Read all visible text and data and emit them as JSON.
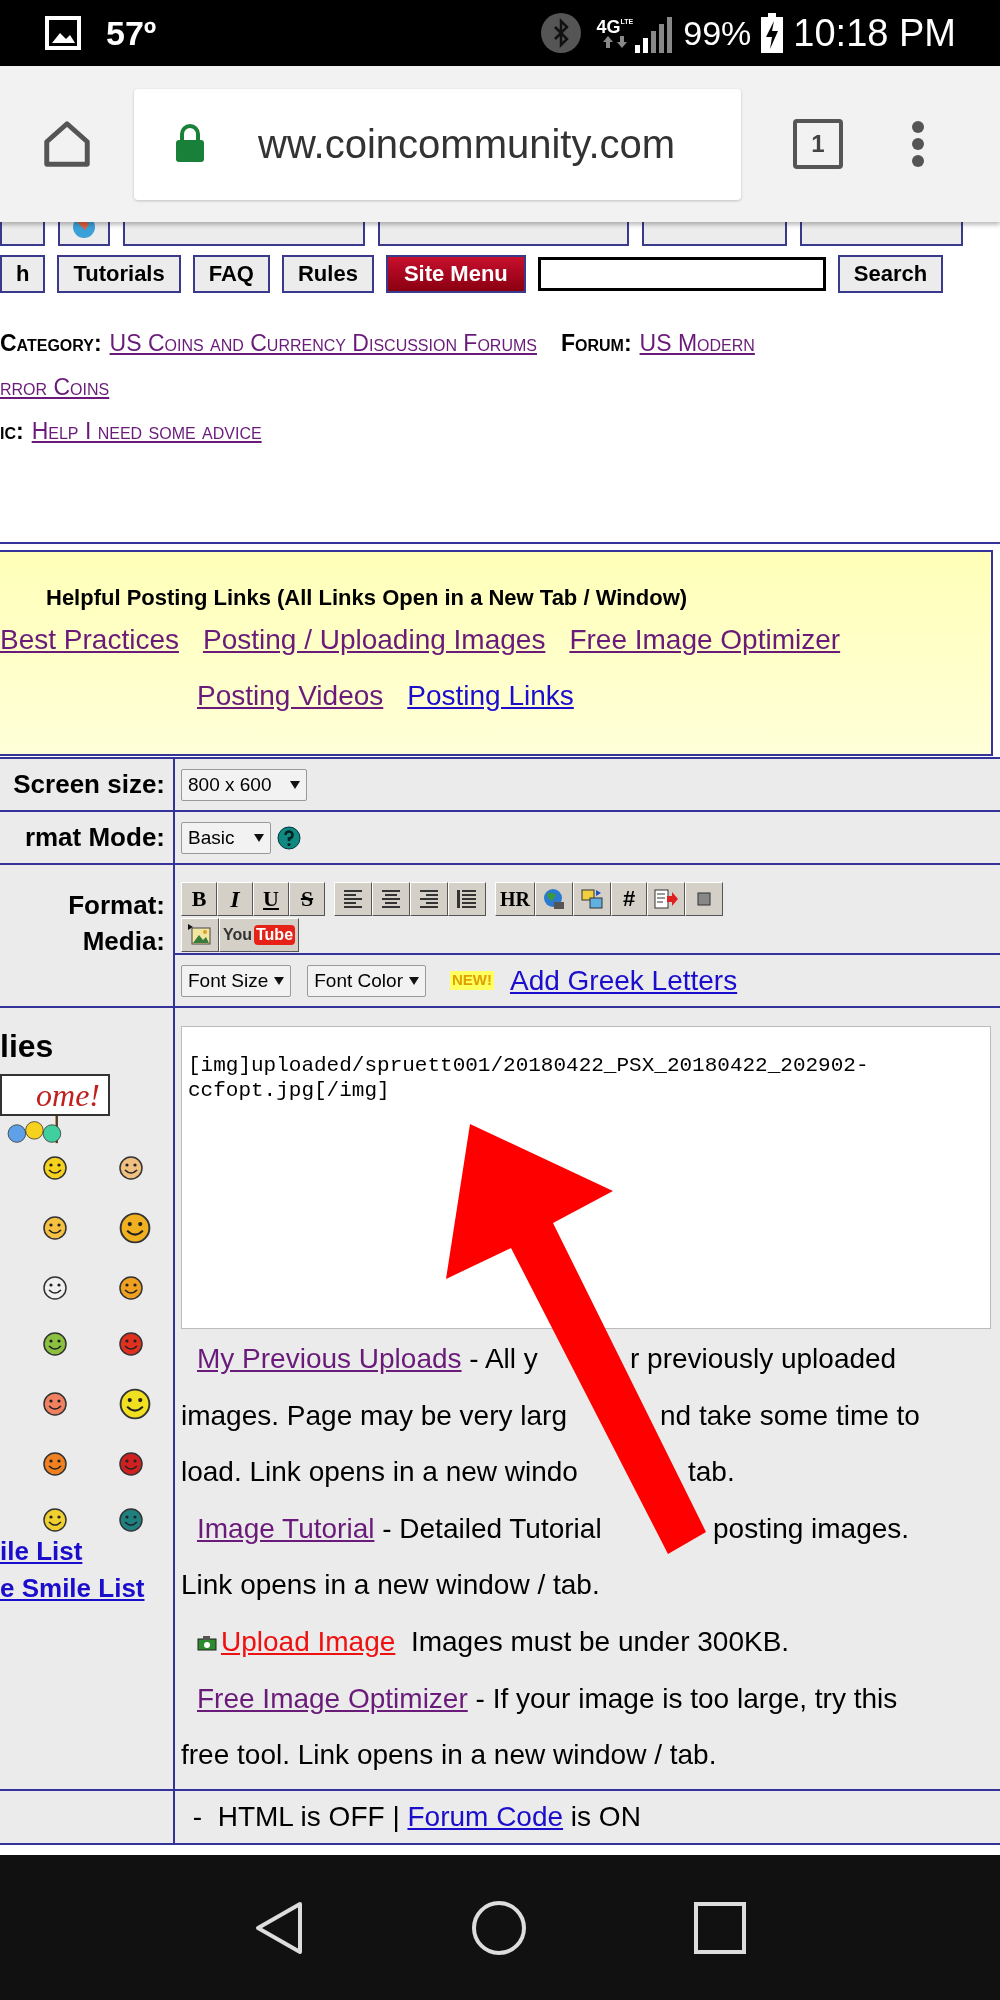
{
  "status_bar": {
    "temperature": "57º",
    "network": "4G",
    "network_sub": "LTE",
    "battery": "99%",
    "time": "10:18 PM"
  },
  "browser": {
    "url": "ww.coincommunity.com",
    "tab_count": "1"
  },
  "nav_rows": [
    [
      {
        "kind": "cut-button"
      },
      {
        "kind": "icon-button"
      },
      {
        "kind": "cut-button"
      },
      {
        "kind": "cut-button"
      },
      {
        "kind": "cut-button"
      },
      {
        "kind": "cut-button"
      }
    ],
    [
      {
        "kind": "button",
        "label": "h"
      },
      {
        "kind": "button",
        "label": "Tutorials"
      },
      {
        "kind": "button",
        "label": "FAQ"
      },
      {
        "kind": "button",
        "label": "Rules"
      },
      {
        "kind": "menu",
        "label": "Site Menu"
      },
      {
        "kind": "search-field"
      },
      {
        "kind": "button",
        "label": "Search"
      }
    ]
  ],
  "breadcrumb": {
    "category_label": "Category:",
    "category_link": "US Coins and Currency Discussion Forums",
    "forum_label": "Forum:",
    "forum_link_lines": [
      "US Modern",
      "rror Coins"
    ],
    "topic_label": "ic:",
    "topic_link": "Help I need some advice"
  },
  "helpful_links": {
    "title": "Helpful Posting Links (All Links Open in a New Tab / Window)",
    "links": [
      {
        "text": "Best Practices",
        "visited": true
      },
      {
        "text": "Posting / Uploading Images",
        "visited": true
      },
      {
        "text": "Free Image Optimizer",
        "visited": true
      },
      {
        "text": "Posting Videos",
        "visited": true
      },
      {
        "text": "Posting Links",
        "visited": false
      }
    ]
  },
  "form": {
    "screen_size": {
      "label": "Screen size:",
      "value": "800 x 600"
    },
    "format_mode": {
      "label": "rmat Mode:",
      "value": "Basic"
    },
    "format_label": "Format:",
    "media_label": "Media:",
    "format_groups": [
      [
        {
          "kind": "bold",
          "label": "B"
        },
        {
          "kind": "italic",
          "label": "I"
        },
        {
          "kind": "underline",
          "label": "U"
        },
        {
          "kind": "strike",
          "label": "S"
        }
      ],
      [
        {
          "kind": "align-left"
        },
        {
          "kind": "align-center"
        },
        {
          "kind": "align-right"
        },
        {
          "kind": "justify"
        }
      ],
      [
        {
          "kind": "text",
          "label": "HR"
        },
        {
          "kind": "globe"
        },
        {
          "kind": "swap"
        },
        {
          "kind": "hash",
          "label": "#"
        },
        {
          "kind": "doc-arrow"
        },
        {
          "kind": "square"
        }
      ]
    ],
    "media_buttons": [
      {
        "kind": "image"
      },
      {
        "kind": "youtube",
        "label": "You",
        "label2": "Tube"
      }
    ],
    "font_selects": [
      "Font Size",
      "Font Color"
    ],
    "new_badge": "NEW!",
    "greek_link": "Add Greek Letters",
    "smilies_label": "lies",
    "welcome_sign": "ome!",
    "smile_links": [
      "ile List",
      "e Smile List"
    ],
    "message": "[img]uploaded/spruett001/20180422_PSX_20180422_202902-ccfopt.jpg[/img]",
    "help_lines": [
      {
        "before": [
          {
            "kind": "link",
            "text": "My Previous Uploads",
            "visited": true
          },
          {
            "kind": "text",
            "text": " - All y"
          }
        ],
        "after": [
          {
            "kind": "text",
            "text": "r previously uploaded"
          }
        ]
      },
      {
        "before": [
          {
            "kind": "text",
            "text": "images. Page may be very larg"
          }
        ],
        "after": [
          {
            "kind": "text",
            "text": "nd take some time to"
          }
        ]
      },
      {
        "before": [
          {
            "kind": "text",
            "text": "load. Link opens in a new windo"
          }
        ],
        "after": [
          {
            "kind": "text",
            "text": "tab."
          }
        ]
      },
      {
        "before": [
          {
            "kind": "link",
            "text": "Image Tutorial",
            "visited": true
          },
          {
            "kind": "text",
            "text": " - Detailed Tutorial"
          }
        ],
        "after": [
          {
            "kind": "text",
            "text": "posting images."
          }
        ]
      },
      {
        "before": [
          {
            "kind": "text",
            "text": "Link opens in a new window / tab."
          }
        ]
      },
      {
        "before": [
          {
            "kind": "upload",
            "text": "Upload Image"
          },
          {
            "kind": "text",
            "text": "  Images must be under 300KB."
          }
        ]
      },
      {
        "before": [
          {
            "kind": "link",
            "text": "Free Image Optimizer",
            "visited": true
          },
          {
            "kind": "text",
            "text": " - If your image is too large, try this"
          }
        ]
      },
      {
        "before": [
          {
            "kind": "text",
            "text": "free tool. Link opens in a new window / tab."
          }
        ]
      }
    ],
    "footer": {
      "prefix": " -  HTML is OFF | ",
      "link": "Forum Code",
      "suffix": " is ON"
    }
  }
}
